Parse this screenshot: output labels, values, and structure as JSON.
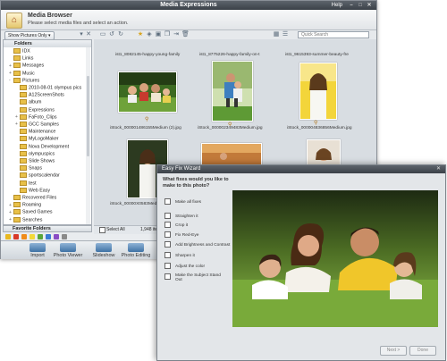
{
  "main_window": {
    "title": "Media Expressions",
    "help": "Help",
    "header_title": "Media Browser",
    "header_subtitle": "Please select media files and select an action.",
    "show_pictures": "Show Pictures Only",
    "search_placeholder": "Quick Search"
  },
  "folders": {
    "heading": "Folders",
    "items": [
      {
        "label": "IDX",
        "depth": 1,
        "expand": ""
      },
      {
        "label": "Links",
        "depth": 1,
        "expand": ""
      },
      {
        "label": "Messages",
        "depth": 1,
        "expand": "+"
      },
      {
        "label": "Music",
        "depth": 1,
        "expand": "+"
      },
      {
        "label": "Pictures",
        "depth": 1,
        "expand": "-"
      },
      {
        "label": "2010-08-01 olympus pics",
        "depth": 2,
        "expand": ""
      },
      {
        "label": "A12ScreenShots",
        "depth": 2,
        "expand": ""
      },
      {
        "label": "album",
        "depth": 2,
        "expand": ""
      },
      {
        "label": "Expressions",
        "depth": 2,
        "expand": ""
      },
      {
        "label": "FaFoto_Clips",
        "depth": 2,
        "expand": "+"
      },
      {
        "label": "GCC Samples",
        "depth": 2,
        "expand": "+"
      },
      {
        "label": "Maintenance",
        "depth": 2,
        "expand": ""
      },
      {
        "label": "MyLogoMaker",
        "depth": 2,
        "expand": ""
      },
      {
        "label": "Nova Development",
        "depth": 2,
        "expand": ""
      },
      {
        "label": "olympuspics",
        "depth": 2,
        "expand": ""
      },
      {
        "label": "Slide Shows",
        "depth": 2,
        "expand": ""
      },
      {
        "label": "Snaps",
        "depth": 2,
        "expand": ""
      },
      {
        "label": "sportscalendar",
        "depth": 2,
        "expand": ""
      },
      {
        "label": "test",
        "depth": 2,
        "expand": ""
      },
      {
        "label": "Web Easy",
        "depth": 2,
        "expand": ""
      },
      {
        "label": "Recovered Files",
        "depth": 1,
        "expand": ""
      },
      {
        "label": "Roaming",
        "depth": 1,
        "expand": "+"
      },
      {
        "label": "Saved Games",
        "depth": 1,
        "expand": "+"
      },
      {
        "label": "Searches",
        "depth": 1,
        "expand": "+"
      }
    ],
    "favorites": "Favorite Folders",
    "label_colors": [
      "#e8b820",
      "#d83a2a",
      "#f08c1a",
      "#f3d93a",
      "#5aa53a",
      "#3b7bd4",
      "#8a4cc4",
      "#8a8a8a"
    ]
  },
  "thumbnails": {
    "files": [
      "ist1_8082145-happy-young-family",
      "ist1_8775226-happy-family-on-t",
      "ist1_9615393-summer-beauty-fre",
      "iStock_000001486155Medium (2).jpg",
      "iStock_000002349483Medium.jpg",
      "iStock_000004836856Medium.jpg"
    ],
    "select_all": "Select All",
    "count": "1,948 item(s)"
  },
  "bottom_bar": {
    "buttons": [
      "Import",
      "Photo Viewer",
      "Slideshow",
      "Photo Editing"
    ]
  },
  "dialog": {
    "title": "Easy Fix Wizard",
    "question": "What fixes would you like to make to this photo?",
    "options": [
      "Make all fixes",
      "Straighten it",
      "Crop it",
      "Fix Red-Eye",
      "Add Brightness and Contrast",
      "Sharpen it",
      "Adjust the color",
      "Make the Subject Stand Out"
    ],
    "next_label": "Next >",
    "done_label": "Done"
  }
}
